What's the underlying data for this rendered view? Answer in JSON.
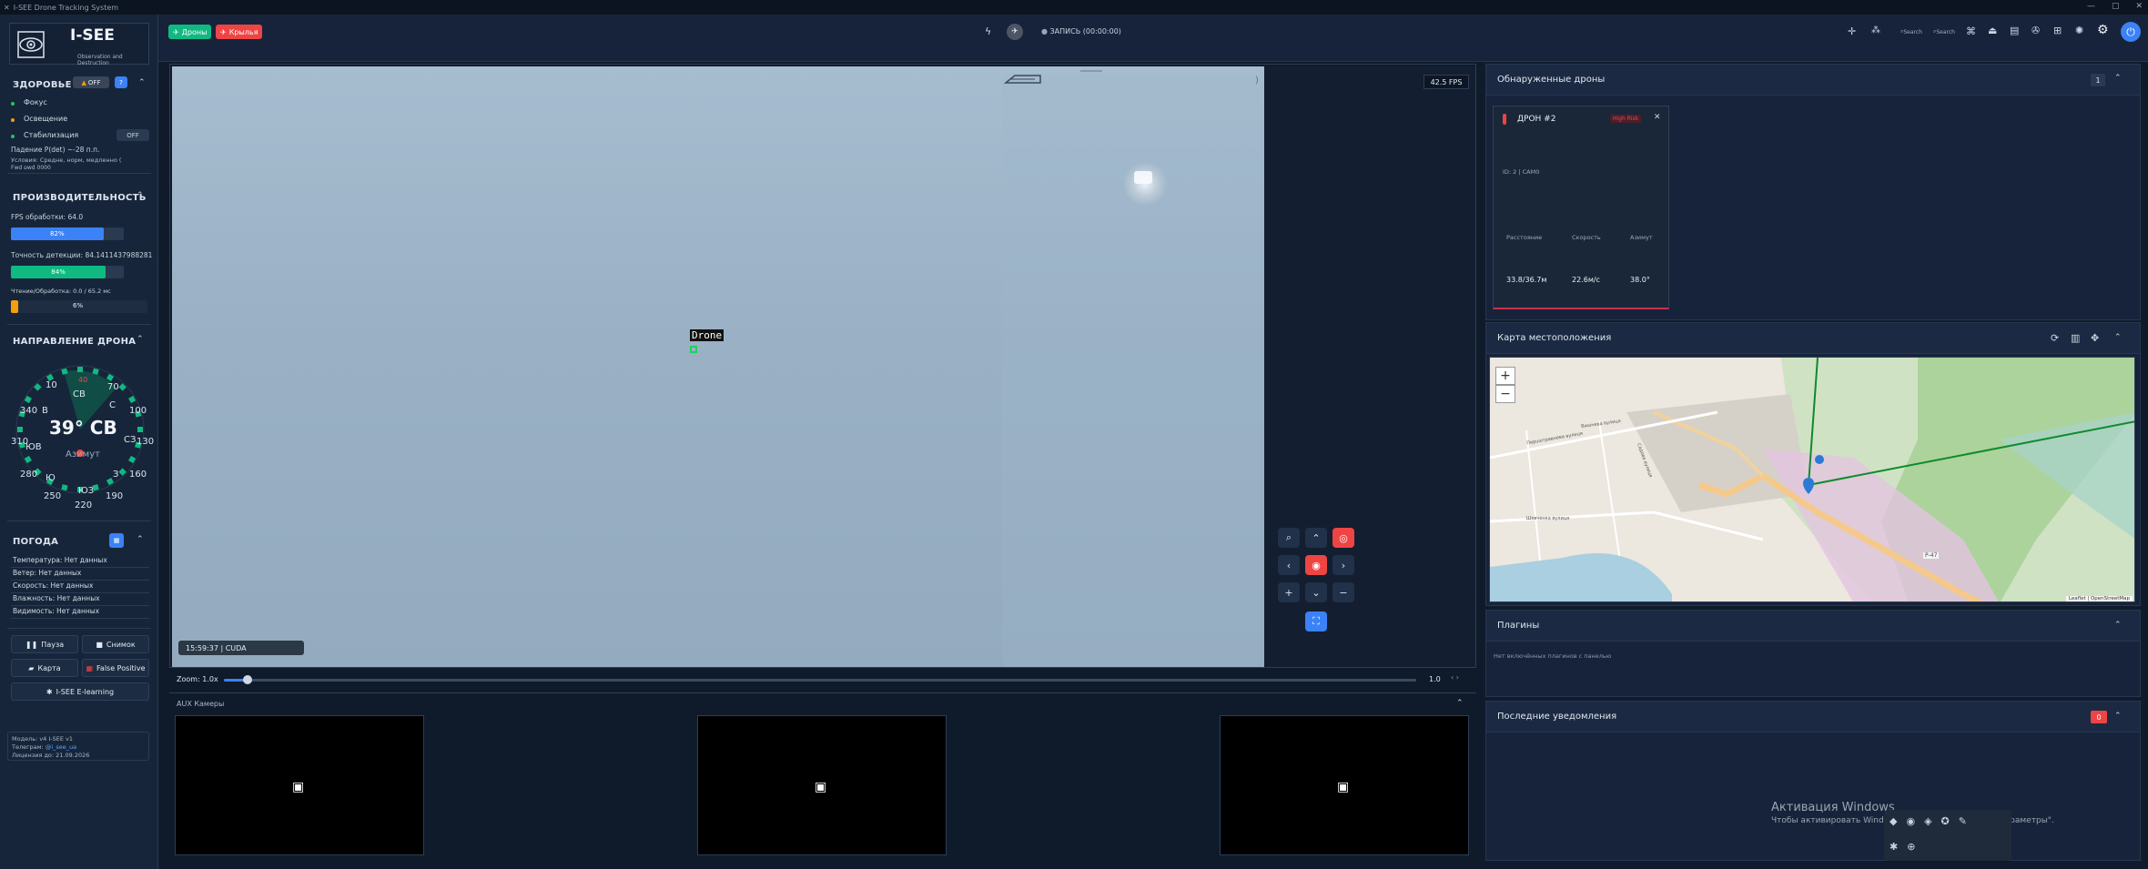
{
  "window": {
    "title": "I-SEE Drone Tracking System"
  },
  "logo": {
    "name": "I-SEE",
    "tagline": "Observation and Destruction"
  },
  "health": {
    "title": "ЗДОРОВЬЕ I",
    "toggle": "OFF",
    "items": [
      {
        "label": "Фокус",
        "color": "#22c55e"
      },
      {
        "label": "Освещение",
        "color": "#f59e0b"
      },
      {
        "label": "Стабилизация",
        "color": "#22c55e",
        "badge": "OFF"
      }
    ],
    "fall": "Падение P(det) ~-28 п.п.",
    "state": "Условия: Средне, норм, медленно (",
    "fwd": "Fwd pwd 0000"
  },
  "performance": {
    "title": "ПРОИЗВОДИТЕЛЬНОСТЬ",
    "fps_label": "FPS обработки: 64.0",
    "fps_pct": "82%",
    "fps_value": 82,
    "acc_label": "Точность детекции: 84.1411437988281",
    "acc_pct": "84%",
    "acc_value": 84,
    "read_label": "Чтение/Обработка: 0.0 / 65.2 мс",
    "read_pct": "6%",
    "read_value": 6
  },
  "direction": {
    "title": "НАПРАВЛЕНИЕ ДРОНА",
    "value": "39° СВ",
    "sub": "Азимут",
    "ticks": [
      "10",
      "40",
      "70",
      "100",
      "130",
      "160",
      "190",
      "220",
      "250",
      "280",
      "310",
      "340"
    ],
    "points": [
      "СВ",
      "С",
      "В",
      "СЗ",
      "ЮВ",
      "Ю",
      "ЮЗ",
      "З"
    ]
  },
  "weather": {
    "title": "ПОГОДА",
    "rows": [
      "Температура: Нет данных",
      "Ветер: Нет данных",
      "Скорость: Нет данных",
      "Влажность: Нет данных",
      "Видимость: Нет данных"
    ]
  },
  "controls": {
    "pause": "Пауза",
    "snapshot": "Снимок",
    "map": "Карта",
    "false_positive": "False Positive",
    "learning": "I-SEE E-learning"
  },
  "footer": {
    "model": "Модель: v4 I-SEE v1",
    "telegram_label": "Телеграм: ",
    "telegram": "@i_see_ua",
    "license": "Лицензия до: 21.09.2026"
  },
  "topbar": {
    "drones_btn": "Дроны",
    "wings_btn": "Крылья",
    "record": "ЗАПИСЬ (00:00:00)",
    "search1": "Search",
    "search2": "Search"
  },
  "video": {
    "fps": "42.5 FPS",
    "cam_info": "15:59:37 | CUDA",
    "detection_label": "Drone"
  },
  "zoom": {
    "label": "Zoom: 1.0x",
    "value": "1.0",
    "level": 0.02
  },
  "aux": {
    "title": "AUX Камеры"
  },
  "detected": {
    "title": "Обнаруженные дроны",
    "count": "1",
    "card": {
      "name": "ДРОН #2",
      "risk": "High Risk",
      "id": "ID: 2 | CAM0",
      "dist_label": "Расстояние",
      "speed_label": "Скорость",
      "az_label": "Азимут",
      "dist": "33.8/36.7м",
      "speed": "22.6м/с",
      "az": "38.0°"
    }
  },
  "map": {
    "title": "Карта местоположения",
    "zoom_in": "+",
    "zoom_out": "−",
    "attribution": "Leaflet | OpenStreetMap",
    "road": "Р-47",
    "streets": [
      "Першотравнева вулиця",
      "Шевченка вулиця",
      "Вишнева вулиця",
      "Садова вулиця"
    ]
  },
  "plugins": {
    "title": "Плагины",
    "empty": "Нет включённых плагинов с панелью"
  },
  "notifications": {
    "title": "Последние уведомления",
    "count": "0"
  },
  "os": {
    "activate_title": "Активация Windows",
    "activate_sub": "Чтобы активировать Windows, перейдите в раздел \"Параметры\"."
  },
  "colors": {
    "accent": "#3b82f6",
    "green": "#10b981",
    "danger": "#ef4444",
    "orange": "#f59e0b"
  }
}
